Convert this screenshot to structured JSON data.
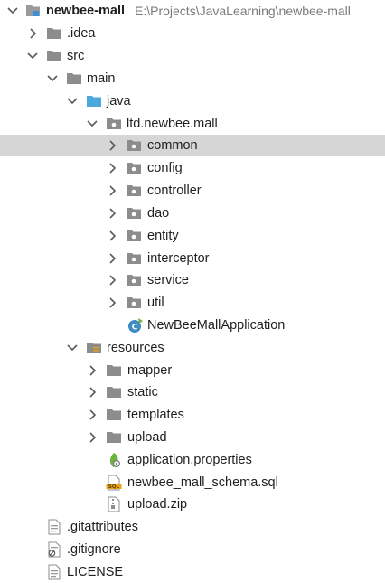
{
  "project": {
    "name": "newbee-mall",
    "path": "E:\\Projects\\JavaLearning\\newbee-mall"
  },
  "nodes": [
    {
      "label": "newbee-mall",
      "icon": "project-folder-icon",
      "expanded": true
    },
    {
      "label": ".idea",
      "icon": "folder-icon",
      "expanded": false
    },
    {
      "label": "src",
      "icon": "folder-icon",
      "expanded": true
    },
    {
      "label": "main",
      "icon": "folder-icon",
      "expanded": true
    },
    {
      "label": "java",
      "icon": "source-folder-icon",
      "expanded": true
    },
    {
      "label": "ltd.newbee.mall",
      "icon": "package-icon",
      "expanded": true
    },
    {
      "label": "common",
      "icon": "package-icon",
      "expanded": false,
      "selected": true
    },
    {
      "label": "config",
      "icon": "package-icon",
      "expanded": false
    },
    {
      "label": "controller",
      "icon": "package-icon",
      "expanded": false
    },
    {
      "label": "dao",
      "icon": "package-icon",
      "expanded": false
    },
    {
      "label": "entity",
      "icon": "package-icon",
      "expanded": false
    },
    {
      "label": "interceptor",
      "icon": "package-icon",
      "expanded": false
    },
    {
      "label": "service",
      "icon": "package-icon",
      "expanded": false
    },
    {
      "label": "util",
      "icon": "package-icon",
      "expanded": false
    },
    {
      "label": "NewBeeMallApplication",
      "icon": "spring-boot-class-icon"
    },
    {
      "label": "resources",
      "icon": "resources-folder-icon",
      "expanded": true
    },
    {
      "label": "mapper",
      "icon": "folder-icon",
      "expanded": false
    },
    {
      "label": "static",
      "icon": "folder-icon",
      "expanded": false
    },
    {
      "label": "templates",
      "icon": "folder-icon",
      "expanded": false
    },
    {
      "label": "upload",
      "icon": "folder-icon",
      "expanded": false
    },
    {
      "label": "application.properties",
      "icon": "spring-properties-icon"
    },
    {
      "label": "newbee_mall_schema.sql",
      "icon": "sql-file-icon"
    },
    {
      "label": "upload.zip",
      "icon": "archive-file-icon"
    },
    {
      "label": ".gitattributes",
      "icon": "text-file-icon"
    },
    {
      "label": ".gitignore",
      "icon": "ignore-file-icon"
    },
    {
      "label": "LICENSE",
      "icon": "text-file-icon"
    }
  ],
  "colors": {
    "selection": "#d6d6d6",
    "folder": "#8c8c8c",
    "source_folder": "#4aa8dc",
    "spring_green": "#6db33f",
    "path_text": "#7a7a7a"
  }
}
